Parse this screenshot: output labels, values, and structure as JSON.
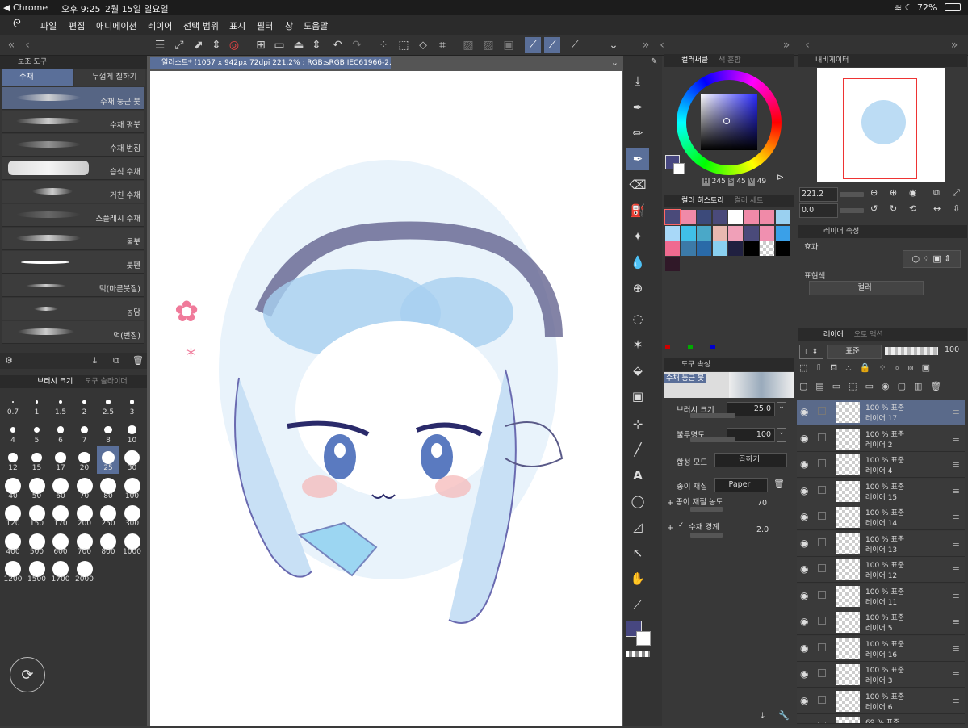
{
  "status": {
    "app": "◀ Chrome",
    "time": "오후 9:25",
    "date": "2월 15일 일요일",
    "battery": "72%"
  },
  "menu": [
    "파일",
    "편집",
    "애니메이션",
    "레이어",
    "선택 범위",
    "표시",
    "필터",
    "창",
    "도움말"
  ],
  "doc_tab": "일러스트* (1057 x 942px 72dpi 221.2% : RGB:sRGB IEC61966-2.1)",
  "sub_tool": {
    "title": "보조 도구",
    "tabs": [
      "수채",
      "두껍게 칠하기"
    ],
    "brushes": [
      "수채 둥근 붓",
      "수채 평붓",
      "수채 번짐",
      "습식 수채",
      "거친 수채",
      "스플래시 수채",
      "물붓",
      "붓펜",
      "먹(마른붓질)",
      "농담",
      "먹(번짐)"
    ]
  },
  "brush_size": {
    "tabs": [
      "브러시 크기",
      "도구 슬라이더"
    ],
    "sizes": [
      "0.7",
      "1",
      "1.5",
      "2",
      "2.5",
      "3",
      "4",
      "5",
      "6",
      "7",
      "8",
      "10",
      "12",
      "15",
      "17",
      "20",
      "25",
      "30",
      "40",
      "50",
      "60",
      "70",
      "80",
      "100",
      "120",
      "150",
      "170",
      "200",
      "250",
      "300",
      "400",
      "500",
      "600",
      "700",
      "800",
      "1000",
      "1200",
      "1500",
      "1700",
      "2000"
    ],
    "selected": "25"
  },
  "color_wheel": {
    "tabs": [
      "컬러써클",
      "색 혼합"
    ],
    "h": "245",
    "s": "45",
    "v": "49",
    "h_lbl": "H",
    "s_lbl": "S",
    "v_lbl": "V"
  },
  "color_history": {
    "tabs": [
      "컬러 히스토리",
      "컬러 세트"
    ],
    "colors": [
      "#4a4a7a",
      "#f08aa8",
      "#3c4a7a",
      "#4a4a7a",
      "#ffffff",
      "#f08aa8",
      "#f08aa8",
      "#9ad0f0",
      "#a8d8f8",
      "#40c0e8",
      "#4aa8c8",
      "#e8b8b0",
      "#f0a0b8",
      "#4a4a7a",
      "#f090b0",
      "#3aa0e8",
      "#f06a90",
      "#3c7aa8",
      "#2a6aa8",
      "#8ad0f0",
      "#202040",
      "#000000",
      "#cccccc",
      "#000000",
      "#301828"
    ]
  },
  "tool_props": {
    "title": "도구 속성",
    "brush_name": "수채 둥근 붓",
    "size_label": "브러시 크기",
    "size_val": "25.0",
    "opacity_label": "불투명도",
    "opacity_val": "100",
    "blend_label": "합성 모드",
    "blend_val": "곱하기",
    "paper_label": "종이 재질",
    "paper_val": "Paper",
    "paper_density_label": "종이 재질 농도",
    "paper_density_val": "70",
    "wc_edge_label": "수채 경계",
    "wc_edge_val": "2.0"
  },
  "navigator": {
    "title": "내비게이터",
    "zoom": "221.2",
    "angle": "0.0"
  },
  "layer_prop": {
    "title": "레이어 속성",
    "effect": "효과",
    "expr": "표현색",
    "expr_val": "컬러"
  },
  "layers": {
    "tabs": [
      "레이어",
      "오토 액션"
    ],
    "blend": "표준",
    "opacity": "100",
    "items": [
      {
        "line1": "100 % 표준",
        "line2": "레이어 17"
      },
      {
        "line1": "100 % 표준",
        "line2": "레이어 2"
      },
      {
        "line1": "100 % 표준",
        "line2": "레이어 4"
      },
      {
        "line1": "100 % 표준",
        "line2": "레이어 15"
      },
      {
        "line1": "100 % 표준",
        "line2": "레이어 14"
      },
      {
        "line1": "100 % 표준",
        "line2": "레이어 13"
      },
      {
        "line1": "100 % 표준",
        "line2": "레이어 12"
      },
      {
        "line1": "100 % 표준",
        "line2": "레이어 11"
      },
      {
        "line1": "100 % 표준",
        "line2": "레이어 5"
      },
      {
        "line1": "100 % 표준",
        "line2": "레이어 16"
      },
      {
        "line1": "100 % 표준",
        "line2": "레이어 3"
      },
      {
        "line1": "100 % 표준",
        "line2": "레이어 6"
      },
      {
        "line1": "69 % 표준",
        "line2": ""
      }
    ]
  },
  "colors": {
    "main": "#474780",
    "accent": "#5a6f99"
  }
}
